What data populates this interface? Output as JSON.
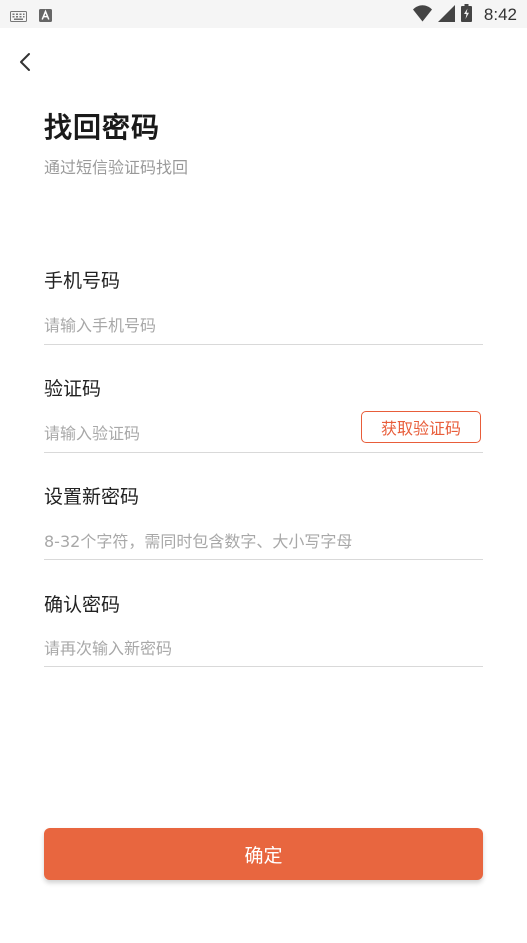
{
  "status_bar": {
    "time": "8:42",
    "icons": [
      "keyboard-icon",
      "a-badge-icon",
      "wifi-icon",
      "signal-icon",
      "battery-icon"
    ]
  },
  "header": {
    "back_icon": "chevron-left-icon",
    "title": "找回密码",
    "subtitle": "通过短信验证码找回"
  },
  "form": {
    "phone": {
      "label": "手机号码",
      "value": "",
      "placeholder": "请输入手机号码"
    },
    "code": {
      "label": "验证码",
      "value": "",
      "placeholder": "请输入验证码",
      "get_code_label": "获取验证码"
    },
    "new_password": {
      "label": "设置新密码",
      "value": "",
      "placeholder": "8-32个字符，需同时包含数字、大小写字母"
    },
    "confirm_password": {
      "label": "确认密码",
      "value": "",
      "placeholder": "请再次输入新密码"
    }
  },
  "confirm_button": {
    "label": "确定"
  },
  "colors": {
    "accent": "#e8663f",
    "code_button_border": "#e85d3a",
    "status_bar_bg": "#f5f5f5"
  }
}
